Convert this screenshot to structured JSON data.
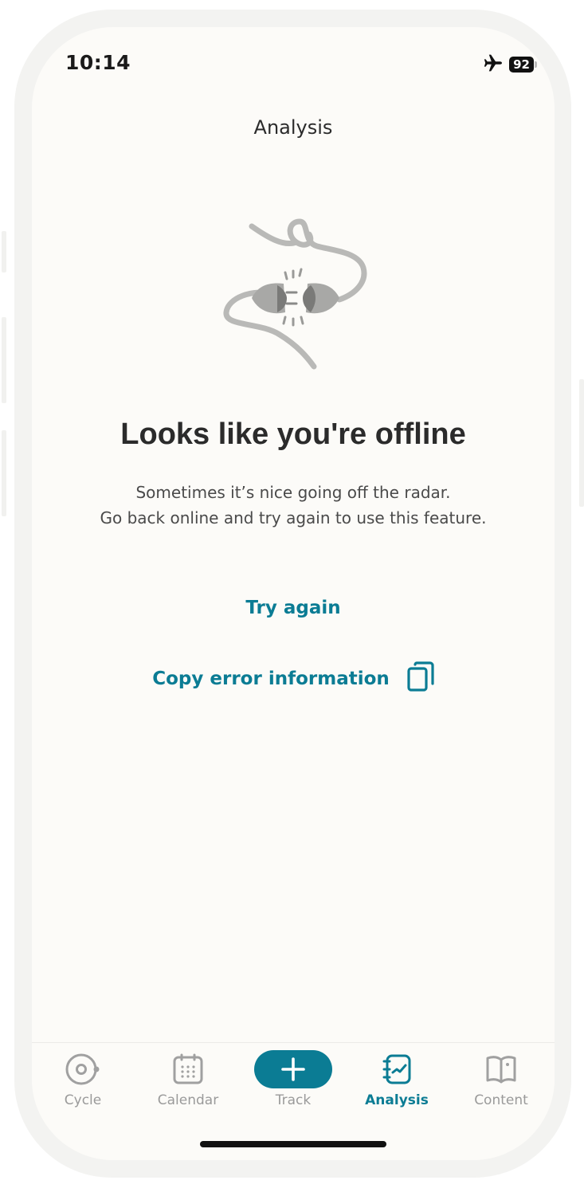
{
  "status": {
    "time": "10:14",
    "battery": "92",
    "airplane_icon": "airplane-icon"
  },
  "header": {
    "title": "Analysis"
  },
  "offline": {
    "illustration": "unplugged-cable-illustration",
    "headline": "Looks like you're offline",
    "message_line1": "Sometimes it’s nice going off the radar.",
    "message_line2": "Go back online and try again to use this feature.",
    "try_again": "Try again",
    "copy_error": "Copy error information",
    "copy_icon": "copy-icon"
  },
  "tabbar": {
    "items": [
      {
        "label": "Cycle",
        "icon": "cycle-icon",
        "active": false
      },
      {
        "label": "Calendar",
        "icon": "calendar-icon",
        "active": false
      },
      {
        "label": "Track",
        "icon": "plus-icon",
        "active": false
      },
      {
        "label": "Analysis",
        "icon": "analysis-icon",
        "active": true
      },
      {
        "label": "Content",
        "icon": "book-icon",
        "active": false
      }
    ]
  },
  "colors": {
    "accent": "#0b7c94",
    "background": "#fcfbf8",
    "text": "#2b2b2b",
    "inactive": "#9a9a9a"
  }
}
